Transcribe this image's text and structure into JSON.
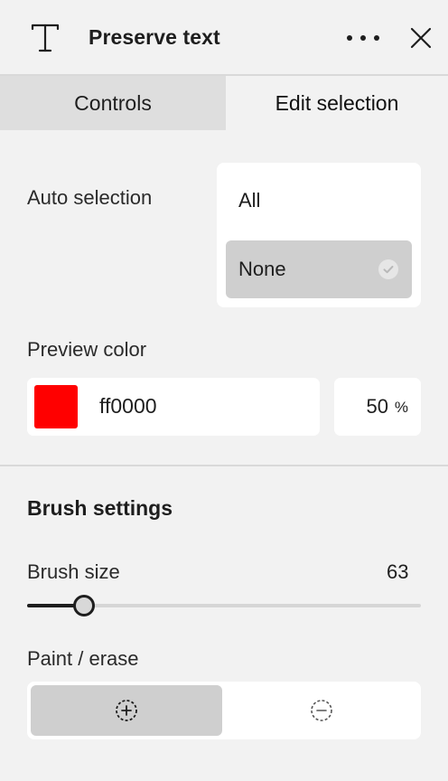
{
  "header": {
    "title": "Preserve text",
    "icon": "text-tool-icon",
    "more_icon": "more-horizontal-icon",
    "close_icon": "close-icon"
  },
  "tabs": [
    {
      "label": "Controls",
      "active": false
    },
    {
      "label": "Edit selection",
      "active": true
    }
  ],
  "auto_selection": {
    "label": "Auto selection",
    "options": [
      {
        "label": "All",
        "selected": false
      },
      {
        "label": "None",
        "selected": true
      }
    ]
  },
  "preview_color": {
    "label": "Preview color",
    "hex": "ff0000",
    "swatch_color": "#ff0000",
    "opacity": "50",
    "opacity_unit": "%"
  },
  "brush_settings": {
    "title": "Brush settings",
    "brush_size_label": "Brush size",
    "brush_size_value": "63",
    "brush_size_fraction": 0.145,
    "paint_erase_label": "Paint / erase",
    "paint_icon": "brush-add-icon",
    "erase_icon": "brush-subtract-icon",
    "active_mode": "paint"
  }
}
